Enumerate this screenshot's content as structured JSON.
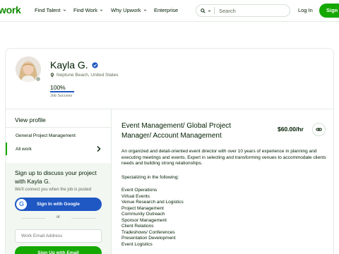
{
  "header": {
    "logo": "work",
    "nav": [
      "Find Talent",
      "Find Work",
      "Why Upwork",
      "Enterprise"
    ],
    "search_placeholder": "Search",
    "login": "Log In",
    "signup": "Sign"
  },
  "profile": {
    "name": "Kayla G.",
    "location": "Neptune Beach, United States",
    "job_success_value": "100%",
    "job_success_fraction": 1.0,
    "job_success_label": "Job Success"
  },
  "sidebar": {
    "view_profile": "View profile",
    "items": [
      "General Project Management",
      "All work"
    ]
  },
  "signup_panel": {
    "title": "Sign up to discuss your project with Kayla G.",
    "subtitle": "We'll connect you when the job is posted",
    "google_button": "Sign In with Google",
    "or": "or",
    "email_placeholder": "Work Email Address",
    "email_button": "Sign Up with Email"
  },
  "main": {
    "title": "Event Management/ Global Project Manager/ Account Management",
    "rate": "$60.00/hr",
    "description": "An organized and detail-oriented event director with over 10 years of experience in planning and executing meetings and events. Expert in selecting and transforming venues to accommodate clients needs and building strong relationships.",
    "specializing": "Specializing in the following:",
    "skills": [
      "Event Operations",
      "Virtual Events",
      "Venue Research and Logistics",
      "Project Management",
      "Community Outreach",
      "Sponsor Management",
      "Client Relations",
      "Tradeshows/ Conferences",
      "Presentation Development",
      "Event Logistics"
    ]
  },
  "colors": {
    "brand_green": "#14a800",
    "logo_green": "#108a00",
    "google_blue": "#1f57c3",
    "panel_bg": "#f2f7f2"
  }
}
